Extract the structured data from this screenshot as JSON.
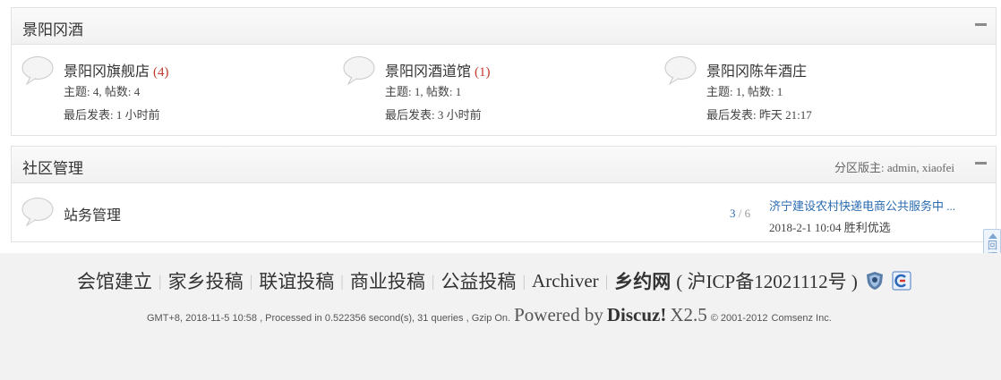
{
  "section1": {
    "title": "景阳冈酒",
    "forums": [
      {
        "name": "景阳冈旗舰店",
        "today": "(4)",
        "stats": "主题: 4, 帖数: 4",
        "last": "最后发表: 1 小时前"
      },
      {
        "name": "景阳冈酒道馆",
        "today": "(1)",
        "stats": "主题: 1, 帖数: 1",
        "last": "最后发表: 3 小时前"
      },
      {
        "name": "景阳冈陈年酒庄",
        "today": "",
        "stats": "主题: 1, 帖数: 1",
        "last": "最后发表: 昨天 21:17"
      }
    ]
  },
  "section2": {
    "title": "社区管理",
    "moderators": "分区版主: admin, xiaofei",
    "forum": {
      "name": "站务管理",
      "topics": "3",
      "posts": "/ 6",
      "last_title": "济宁建设农村快递电商公共服务中 ...",
      "last_meta": "2018-2-1 10:04 胜利优选"
    }
  },
  "footer": {
    "links": [
      "会馆建立",
      "家乡投稿",
      "联谊投稿",
      "商业投稿",
      "公益投稿",
      "Archiver"
    ],
    "site_name": "乡约网",
    "icp": "( 沪ICP备12021112号 )",
    "stats": "GMT+8, 2018-11-5 10:58 , Processed in 0.522356 second(s), 31 queries , Gzip On.",
    "powered_by": "Powered by",
    "product": "Discuz!",
    "version": "X2.5",
    "copyright": "© 2001-2012",
    "company": "Comsenz Inc."
  },
  "back_to_top": "回顶部",
  "colors": {
    "link": "#2a6bb0",
    "today_count": "#c0392b",
    "footer_bg": "#f2f2f2"
  }
}
